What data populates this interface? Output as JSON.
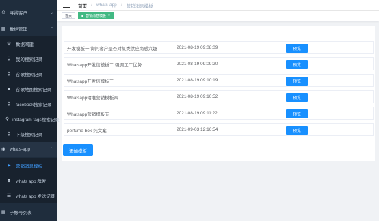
{
  "sidebar": {
    "items": [
      {
        "label": "寻找客户",
        "icon": "compass-icon"
      },
      {
        "label": "数据管理",
        "icon": "grid-icon"
      },
      {
        "label": "数据阐建",
        "icon": "gear-icon"
      },
      {
        "label": "我的搜索记录",
        "icon": "search-icon"
      },
      {
        "label": "谷歌搜索记录",
        "icon": "search-icon"
      },
      {
        "label": "谷歌地图搜索记录",
        "icon": "map-pin-icon"
      },
      {
        "label": "facebook搜索记录",
        "icon": "search-icon"
      },
      {
        "label": "instagram tags搜索记录",
        "icon": "search-icon"
      },
      {
        "label": "下级搜索记录",
        "icon": "search-icon"
      },
      {
        "label": "whats-app",
        "icon": "chat-icon"
      },
      {
        "label": "营销消息模板",
        "icon": "send-icon"
      },
      {
        "label": "whats app 群发",
        "icon": "people-icon"
      },
      {
        "label": "whats app 发送记录",
        "icon": "list-icon"
      },
      {
        "label": "子帐号列表",
        "icon": "grid-icon"
      }
    ]
  },
  "header": {
    "breadcrumb": [
      "首页",
      "whats-app",
      "营销消息模板"
    ]
  },
  "tags": {
    "home": "首页",
    "active": "营销消息模板",
    "close": "×"
  },
  "table": {
    "rows": [
      {
        "name": "开发模板一 询问客户是否对某类供应商感兴趣",
        "time": "2021-08-19 09:08:09",
        "action": "预览"
      },
      {
        "name": "Whatsapp开发信模板二 强调工厂优势",
        "time": "2021-08-19 09:09:20",
        "action": "预览"
      },
      {
        "name": "Whatsapp开发信模板三",
        "time": "2021-08-19 09:10:19",
        "action": "预览"
      },
      {
        "name": "Whatsapp精准营销模板四",
        "time": "2021-08-19 09:10:52",
        "action": "预览"
      },
      {
        "name": "Whatsapp营销模板五",
        "time": "2021-08-19 09:11:22",
        "action": "预览"
      },
      {
        "name": "perfume box-纯文案",
        "time": "2021-09-03 12:16:54",
        "action": "预览"
      }
    ]
  },
  "add_button": "添加模板",
  "colors": {
    "sidebar_bg": "#1f2d3d",
    "accent": "#1890ff",
    "active_tag": "#42b983"
  }
}
